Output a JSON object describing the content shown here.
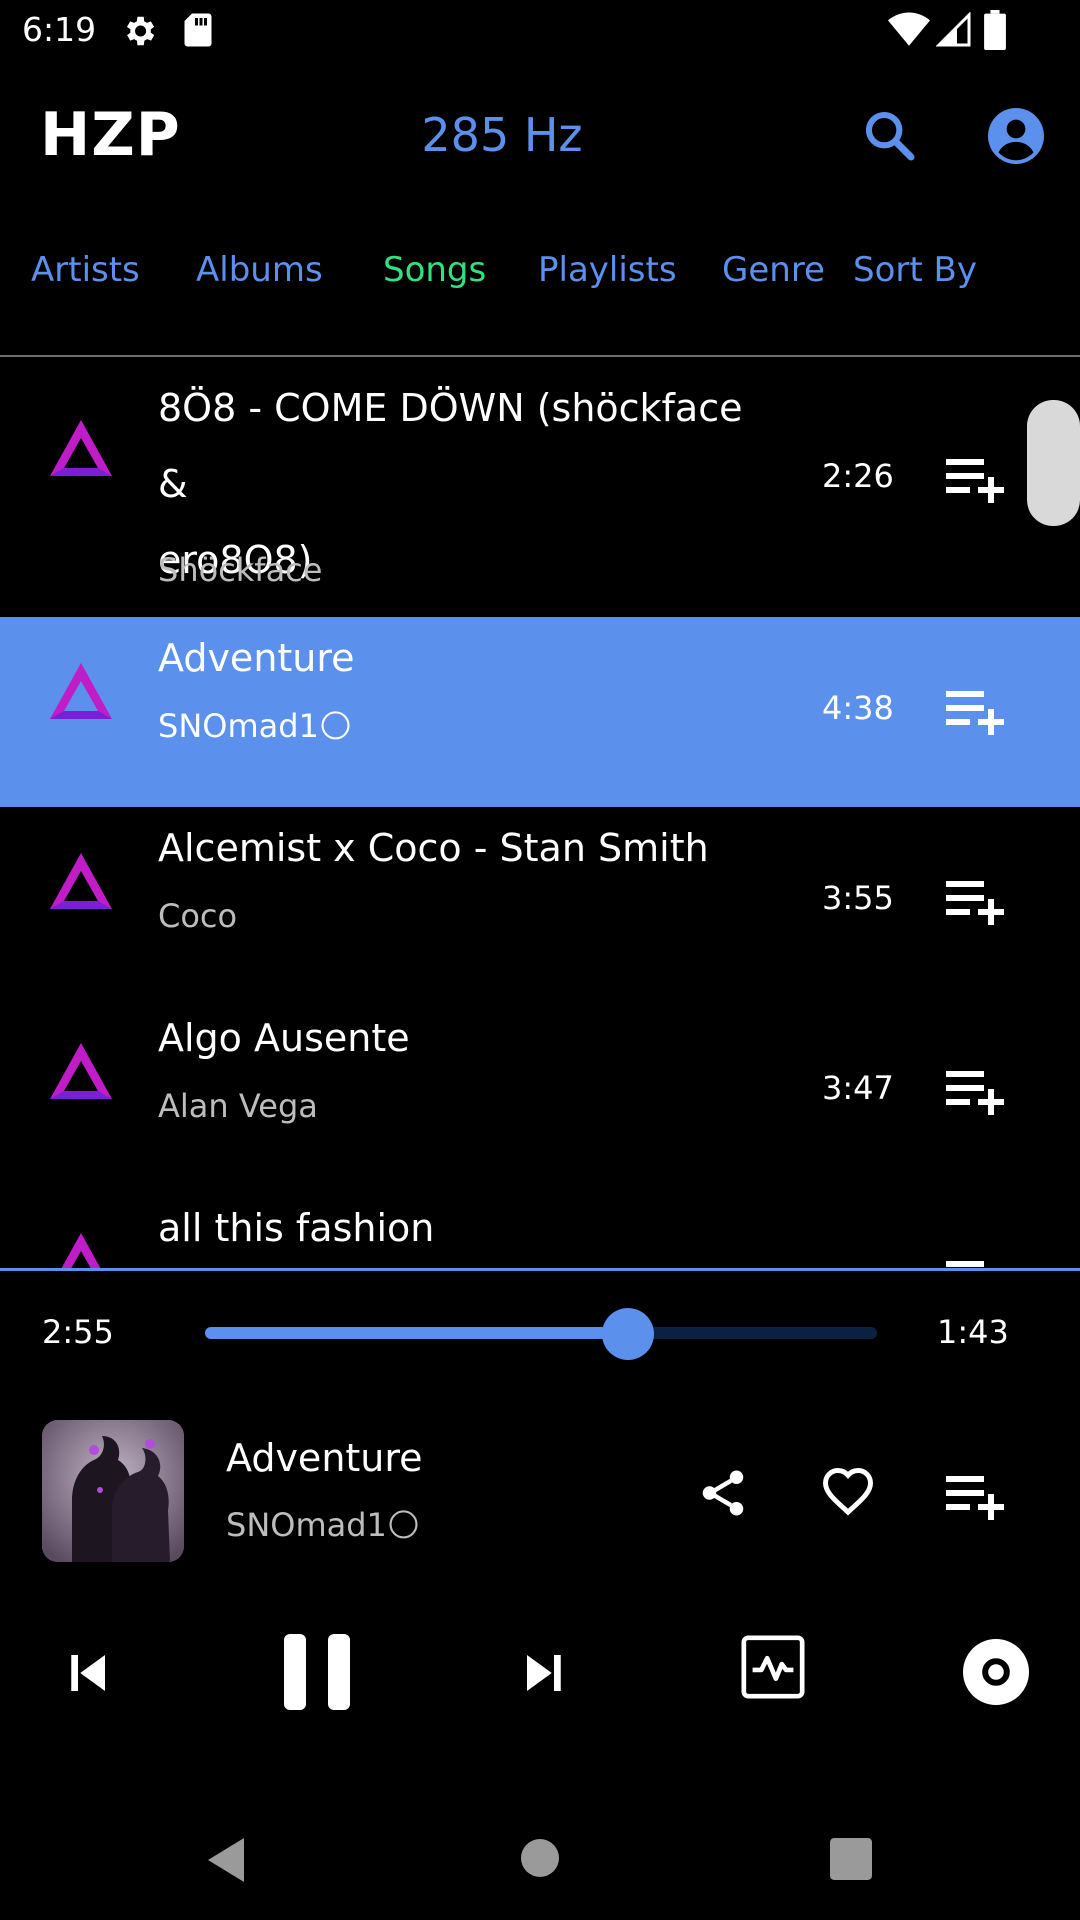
{
  "status_bar": {
    "time": "6:19",
    "icons": [
      "settings-icon",
      "sd-card-icon",
      "wifi-icon",
      "cell-signal-icon",
      "battery-icon"
    ]
  },
  "app_bar": {
    "logo": "HZP",
    "frequency": "285 Hz",
    "icons": [
      "search-icon",
      "account-icon"
    ]
  },
  "tabs": [
    {
      "label": "Artists",
      "active": false
    },
    {
      "label": "Albums",
      "active": false
    },
    {
      "label": "Songs",
      "active": true
    },
    {
      "label": "Playlists",
      "active": false
    },
    {
      "label": "Genre",
      "active": false
    },
    {
      "label": "Sort By",
      "active": false
    }
  ],
  "songs": [
    {
      "title_line1": "8Ö8 - COME DÖWN (shöckface &",
      "title_line2": "ero8O8)",
      "artist": "Shöckface",
      "duration": "2:26",
      "selected": false
    },
    {
      "title": "Adventure",
      "artist": "SNOmad1🌕",
      "duration": "4:38",
      "selected": true
    },
    {
      "title": "Alcemist x Coco - Stan Smith",
      "artist": "Coco",
      "duration": "3:55",
      "selected": false
    },
    {
      "title": "Algo Ausente",
      "artist": "Alan Vega",
      "duration": "3:47",
      "selected": false
    },
    {
      "title": "all this fashion",
      "artist": "",
      "duration": "",
      "selected": false
    }
  ],
  "player": {
    "elapsed": "2:55",
    "remaining": "1:43",
    "progress": 0.63,
    "now_playing_title": "Adventure",
    "now_playing_artist": "SNOmad1🌕",
    "action_icons": [
      "share-icon",
      "heart-icon",
      "playlist-add-icon"
    ],
    "controls": [
      "skip-previous-icon",
      "pause-icon",
      "skip-next-icon",
      "equalizer-icon",
      "repeat-circle-icon"
    ]
  },
  "colors": {
    "accent": "#5b90ec",
    "active_tab": "#2fe27e",
    "background": "#000000"
  }
}
